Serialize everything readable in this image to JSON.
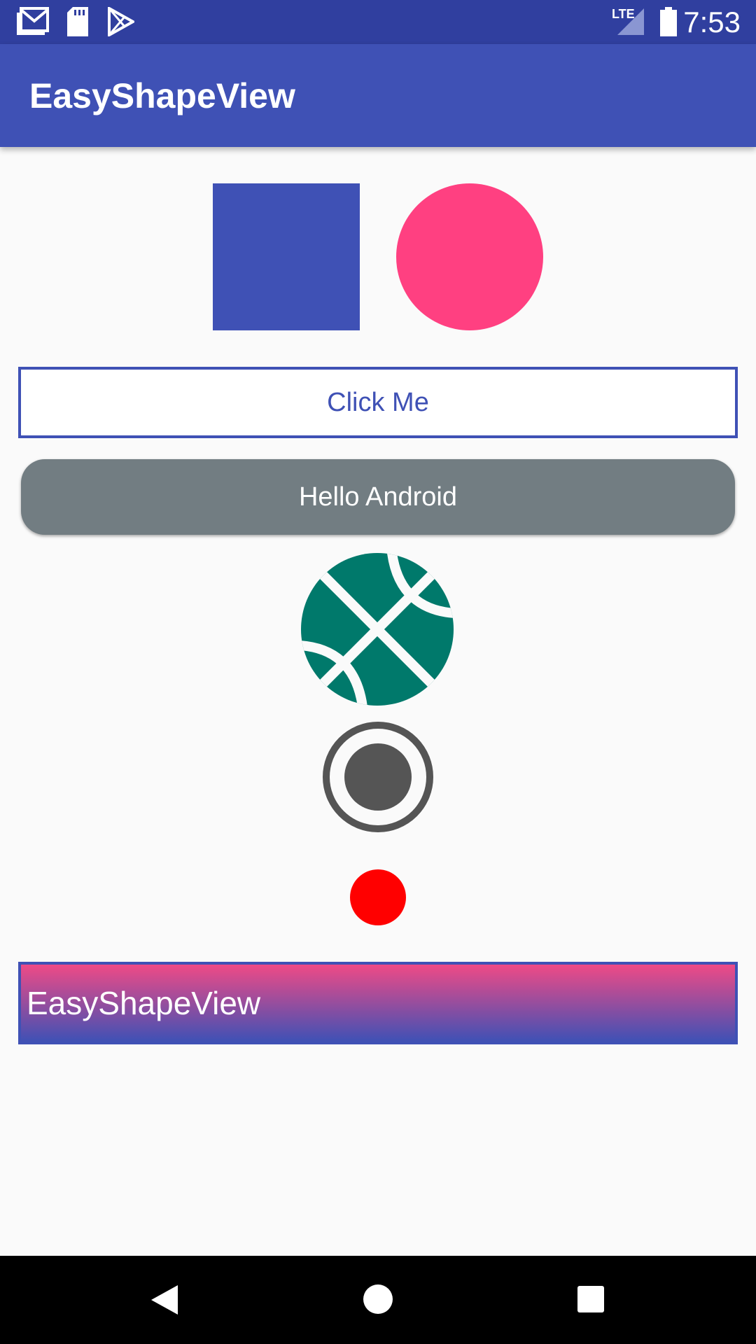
{
  "status_bar": {
    "time": "7:53",
    "network_label": "LTE",
    "icons": [
      "gmail-icon",
      "sd-card-icon",
      "play-store-icon",
      "signal-icon",
      "battery-icon"
    ]
  },
  "app_bar": {
    "title": "EasyShapeView"
  },
  "shapes": {
    "square_color": "#3f51b5",
    "circle_color": "#ff4081",
    "ball_color": "#00796b",
    "radio_color": "#555555",
    "red_dot_color": "#ff0000"
  },
  "buttons": {
    "click_me_label": "Click Me",
    "click_me_color": "#3f51b5",
    "hello_android_label": "Hello Android"
  },
  "gradient_view": {
    "label": "EasyShapeView",
    "gradient_start": "#ef4a86",
    "gradient_end": "#3f51b5"
  },
  "nav_bar": {
    "icons": [
      "back-icon",
      "home-icon",
      "recents-icon"
    ]
  }
}
